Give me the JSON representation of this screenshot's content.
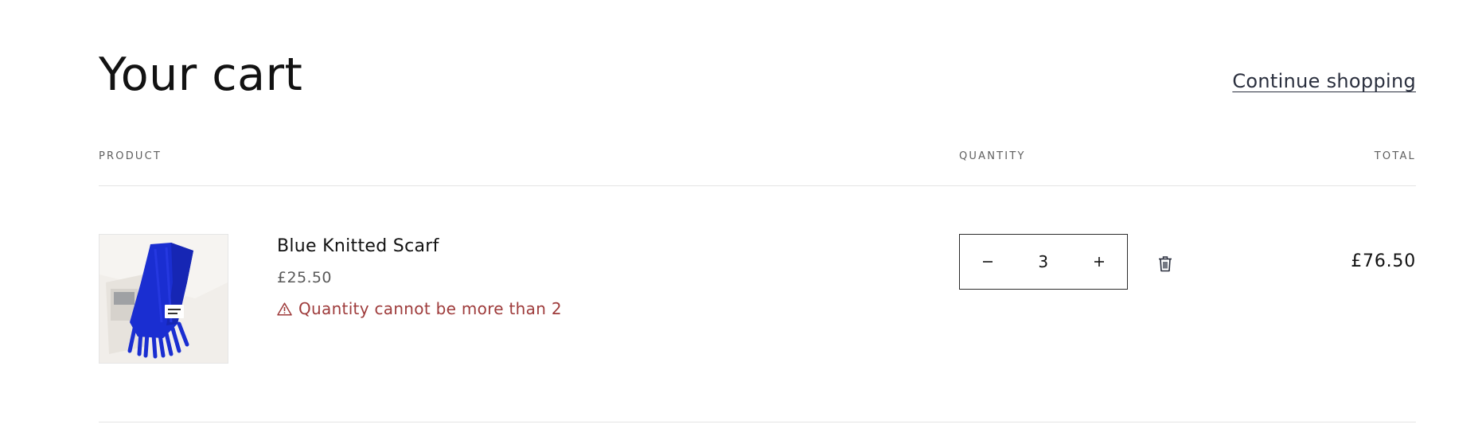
{
  "header": {
    "title": "Your cart",
    "continue_label": "Continue shopping"
  },
  "columns": {
    "product": "Product",
    "quantity": "Quantity",
    "total": "Total"
  },
  "items": [
    {
      "name": "Blue Knitted Scarf",
      "unit_price": "£25.50",
      "error_message": "Quantity cannot be more than 2",
      "quantity": "3",
      "line_total": "£76.50",
      "image_color": "#1a2ed1"
    }
  ],
  "colors": {
    "text": "#121212",
    "muted": "#5f5f5f",
    "error": "#9e3b3b",
    "link": "#2a2f3e",
    "border": "#2b2b2b",
    "divider": "#e4e4e4"
  },
  "icons": {
    "decrease": "minus-icon",
    "increase": "plus-icon",
    "remove": "trash-icon",
    "error": "warning-icon"
  }
}
